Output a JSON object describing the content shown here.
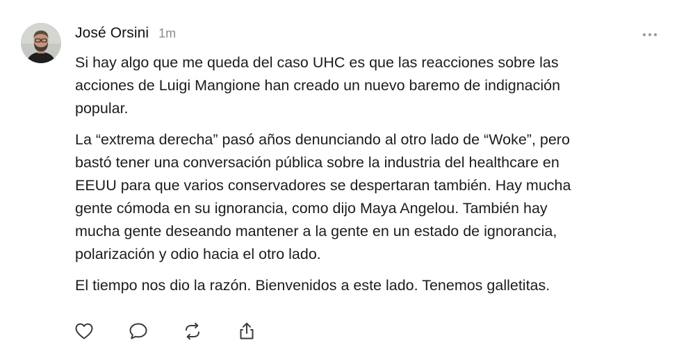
{
  "post": {
    "author": "José Orsini",
    "time": "1m",
    "paragraphs": [
      "Si hay algo que me queda del caso UHC es que las reacciones sobre las\nacciones de Luigi Mangione han creado un nuevo baremo de indignación\npopular.",
      "La “extrema derecha” pasó años denunciando al otro lado de “Woke”, pero\nbastó tener una conversación pública sobre la industria del healthcare en\nEEUU para que varios conservadores se despertaran también. Hay mucha\ngente cómoda en su ignorancia, como dijo Maya Angelou. También hay\nmucha gente deseando mantener a la gente en un estado de ignorancia,\npolarización y odio hacia el otro lado.",
      "El tiempo nos dio la razón. Bienvenidos a este lado. Tenemos galletitas."
    ]
  },
  "icons": {
    "more": "more-horizontal-icon",
    "like": "heart-icon",
    "reply": "comment-icon",
    "repost": "repost-icon",
    "share": "share-icon"
  },
  "colors": {
    "text": "#1c1c1c",
    "muted": "#8a8a8a",
    "icon": "#3a3a3a",
    "background": "#ffffff"
  }
}
